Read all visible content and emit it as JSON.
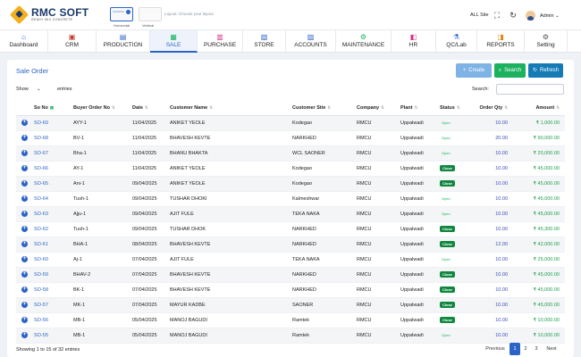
{
  "header": {
    "brand": "RMC SOFT",
    "tagline": "READY MIX CONCRETE",
    "layout_horizontal_label": "Horizontal",
    "layout_vertical_label": "Vertical",
    "layout_hint": "Layout: Choose your layout",
    "site_selector": "ALL Site",
    "user_menu": "Admin ⌄"
  },
  "nav": [
    {
      "label": "Dashboard",
      "icon": "home-icon",
      "glyph": "⌂",
      "color": "#2c63c7"
    },
    {
      "label": "CRM",
      "icon": "crm-icon",
      "glyph": "▣",
      "color": "#c0392b"
    },
    {
      "label": "PRODUCTION",
      "icon": "production-icon",
      "glyph": "▤",
      "color": "#2c63c7"
    },
    {
      "label": "SALE",
      "icon": "sale-icon",
      "glyph": "▦",
      "color": "#1bb15f"
    },
    {
      "label": "PURCHASE",
      "icon": "purchase-icon",
      "glyph": "▥",
      "color": "#d6338a"
    },
    {
      "label": "STORE",
      "icon": "store-icon",
      "glyph": "▧",
      "color": "#2c63c7"
    },
    {
      "label": "ACCOUNTS",
      "icon": "accounts-icon",
      "glyph": "▨",
      "color": "#2c63c7"
    },
    {
      "label": "MAINTENANCE",
      "icon": "maintenance-icon",
      "glyph": "⚙",
      "color": "#1bb15f"
    },
    {
      "label": "HR",
      "icon": "hr-icon",
      "glyph": "◧",
      "color": "#d6338a"
    },
    {
      "label": "QC/Lab",
      "icon": "qc-lab-icon",
      "glyph": "⚗",
      "color": "#2c63c7"
    },
    {
      "label": "REPORTS",
      "icon": "reports-icon",
      "glyph": "◨",
      "color": "#e08a1e"
    },
    {
      "label": "Setting",
      "icon": "gear-icon",
      "glyph": "⚙",
      "color": "#555555"
    }
  ],
  "active_nav": "SALE",
  "panel": {
    "title": "Sale Order",
    "create_label": "Create",
    "search_button_label": "Search",
    "refresh_label": "Refresh",
    "show_label": "Show",
    "entries_label": "entries",
    "search_label": "Search:"
  },
  "table": {
    "headers": [
      "So No",
      "Buyer Order No",
      "Date",
      "Customer Name",
      "Customer Site",
      "Company",
      "Plant",
      "Status",
      "Order Qty",
      "Amount"
    ],
    "rows": [
      [
        "SO-69",
        "AYY-1",
        "11/04/2025",
        "ANIKET YEOLE",
        "Kodegao",
        "RMCU",
        "Uppalwadi",
        "Open",
        "10.00",
        "₹ 1,000.00"
      ],
      [
        "SO-68",
        "BV-1",
        "11/04/2025",
        "BHAVESH KEVTE",
        "NARKHED",
        "RMCU",
        "Uppalwadi",
        "Open",
        "20.00",
        "₹ 90,000.00"
      ],
      [
        "SO-67",
        "Bha-1",
        "11/04/2025",
        "BHANU BHAKTA",
        "WCL SAONER",
        "RMCU",
        "Uppalwadi",
        "Open",
        "10.00",
        "₹ 20,000.00"
      ],
      [
        "SO-66",
        "AY-1",
        "11/04/2025",
        "ANIKET YEOLE",
        "Kodegao",
        "RMCU",
        "Uppalwadi",
        "Close",
        "10.00",
        "₹ 45,000.00"
      ],
      [
        "SO-65",
        "Ani-1",
        "09/04/2025",
        "ANIKET YEOLE",
        "Kodegao",
        "RMCU",
        "Uppalwadi",
        "Close",
        "10.00",
        "₹ 45,000.00"
      ],
      [
        "SO-64",
        "Tush-1",
        "09/04/2025",
        "TUSHAR DHOKI",
        "Kalmeshwar",
        "RMCU",
        "Uppalwadi",
        "Open",
        "10.00",
        "₹ 45,000.00"
      ],
      [
        "SO-63",
        "Ajju-1",
        "09/04/2025",
        "AJIT FULE",
        "TEKA NAKA",
        "RMCU",
        "Uppalwadi",
        "Open",
        "10.00",
        "₹ 45,000.00"
      ],
      [
        "SO-62",
        "Tush-1",
        "09/04/2025",
        "TUSHAR DHOK",
        "NARKHED",
        "RMCU",
        "Uppalwadi",
        "Close",
        "10.00",
        "₹ 45,300.00"
      ],
      [
        "SO-61",
        "BHA-1",
        "08/04/2025",
        "BHAVESH KEVTE",
        "NARKHED",
        "RMCU",
        "Uppalwadi",
        "Close",
        "12.00",
        "₹ 42,000.00"
      ],
      [
        "SO-60",
        "Aj-1",
        "07/04/2025",
        "AJIT FULE",
        "TEKA NAKA",
        "RMCU",
        "Uppalwadi",
        "Open",
        "10.00",
        "₹ 25,000.00"
      ],
      [
        "SO-59",
        "BHAV-2",
        "07/04/2025",
        "BHAVESH KEVTE",
        "NARKHED",
        "RMCU",
        "Uppalwadi",
        "Close",
        "10.00",
        "₹ 45,000.00"
      ],
      [
        "SO-58",
        "BK-1",
        "07/04/2025",
        "BHAVESH KEVTE",
        "NARKHED",
        "RMCU",
        "Uppalwadi",
        "Close",
        "10.00",
        "₹ 45,000.00"
      ],
      [
        "SO-57",
        "MK-1",
        "07/04/2025",
        "MAYUR KADBE",
        "SAONER",
        "RMCU",
        "Uppalwadi",
        "Close",
        "10.00",
        "₹ 45,000.00"
      ],
      [
        "SO-56",
        "MB-1",
        "05/04/2025",
        "MANOJ BAGUDI",
        "Ramtek",
        "RMCU",
        "Uppalwadi",
        "Close",
        "10.00",
        "₹ 10,000.00"
      ],
      [
        "SO-55",
        "MB-1",
        "05/04/2025",
        "MANOJ BAGUDI",
        "Ramtek",
        "RMCU",
        "Uppalwadi",
        "Open",
        "10.00",
        "₹ 10,000.00"
      ]
    ]
  },
  "footer": {
    "info": "Showing 1 to 15 of 32 entries",
    "previous": "Previous",
    "pages": [
      "1",
      "2",
      "3"
    ],
    "next": "Next"
  }
}
